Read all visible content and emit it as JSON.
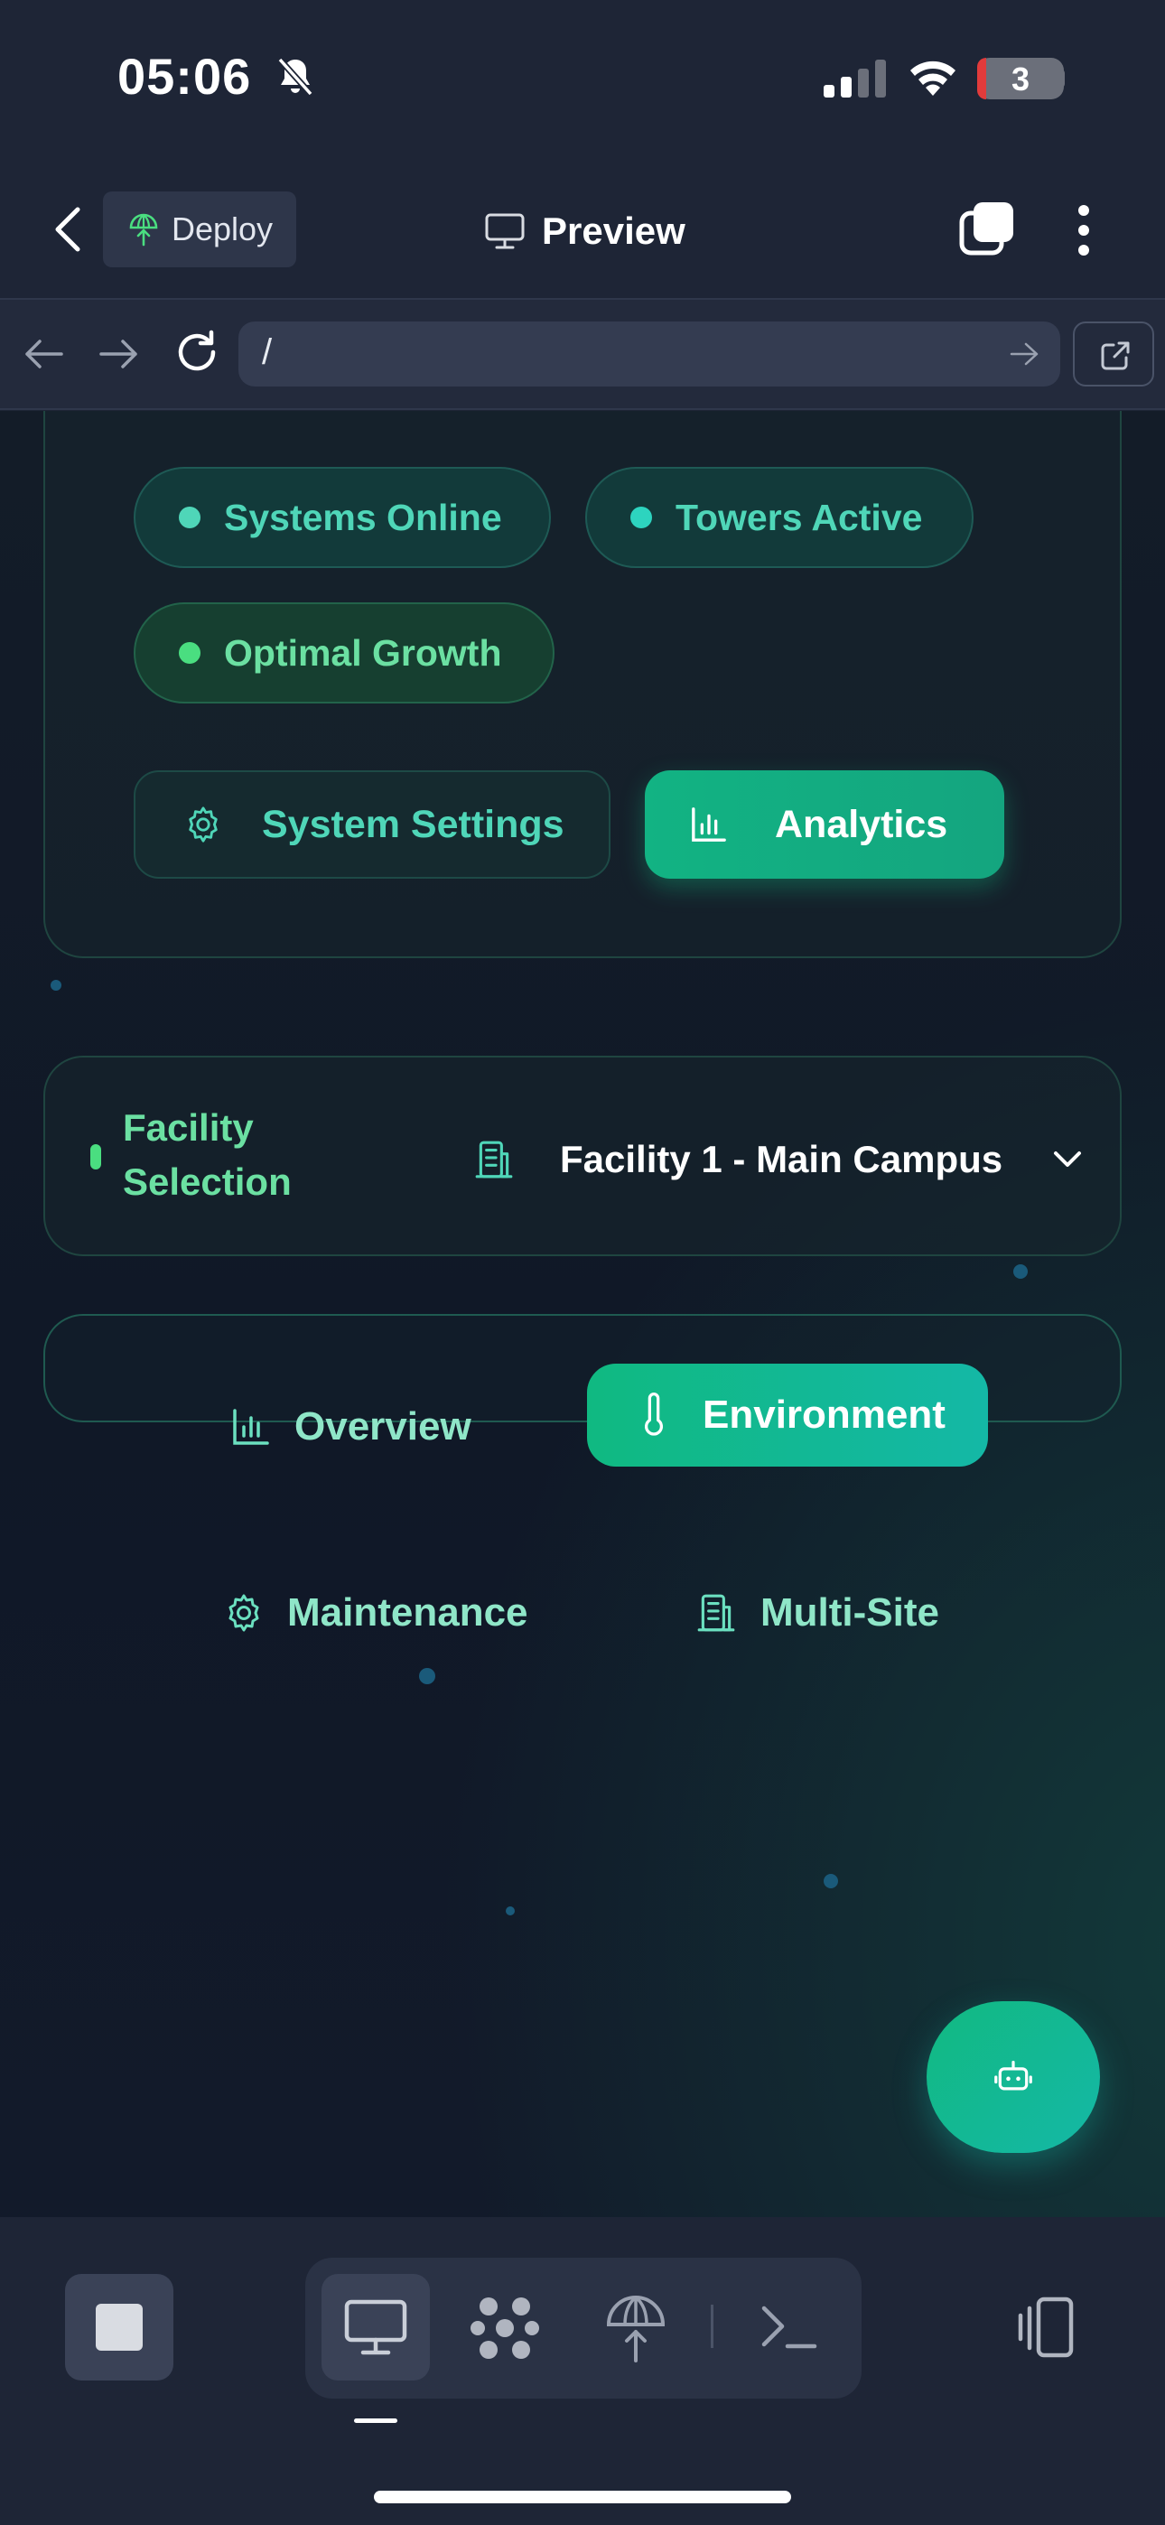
{
  "status_bar": {
    "time": "05:06",
    "battery_level": "3"
  },
  "header": {
    "deploy_label": "Deploy",
    "preview_label": "Preview"
  },
  "url_bar": {
    "url": "/"
  },
  "dashboard": {
    "status_pills": [
      {
        "label": "Systems Online",
        "color": "#4fd6b8"
      },
      {
        "label": "Towers Active",
        "color": "#2dd4bf"
      },
      {
        "label": "Optimal Growth",
        "color": "#4ade80"
      }
    ],
    "settings_button": "System Settings",
    "analytics_button": "Analytics"
  },
  "facility": {
    "title": "Facility Selection",
    "selected": "Facility 1 - Main Campus"
  },
  "nav_tabs": {
    "overview": "Overview",
    "environment": "Environment",
    "maintenance": "Maintenance",
    "multisite": "Multi-Site",
    "active": "environment"
  },
  "colors": {
    "accent": "#10b981",
    "accent_teal": "#14b8a6",
    "background": "#101827",
    "chrome": "#1e2536"
  },
  "icons": {
    "status": [
      "bell-slash-icon",
      "cellular-icon",
      "wifi-icon",
      "battery-icon"
    ],
    "header": [
      "back-chevron-icon",
      "deploy-icon",
      "monitor-icon",
      "tabs-icon",
      "more-vertical-icon"
    ],
    "toolbar": [
      "stop-icon",
      "desktop-icon",
      "workflow-icon",
      "deploy-icon",
      "terminal-icon",
      "rotate-device-icon"
    ]
  }
}
